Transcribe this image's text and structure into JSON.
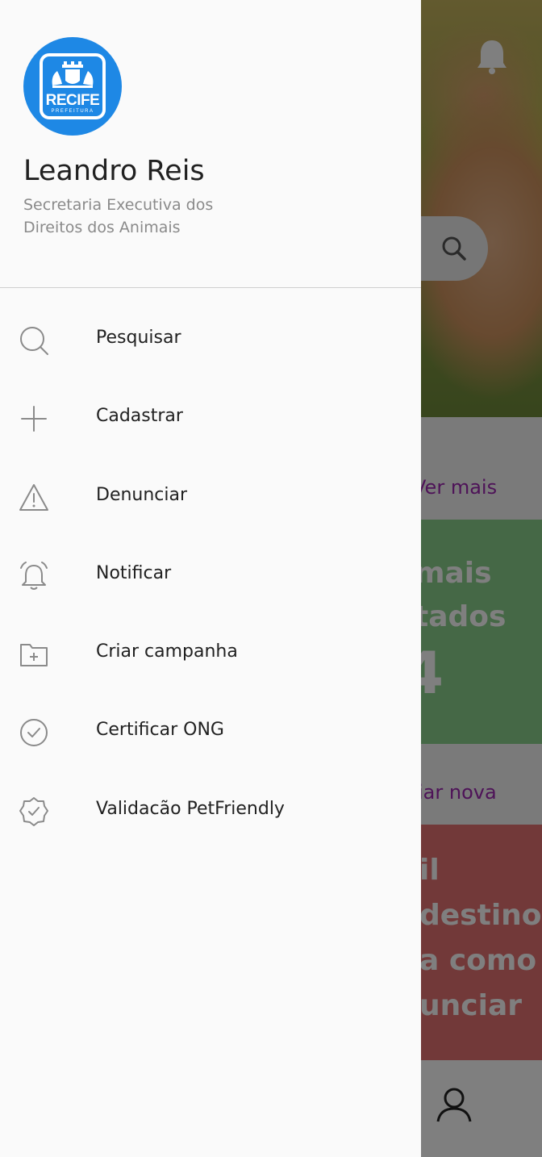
{
  "drawer": {
    "logo": {
      "brand": "RECIFE",
      "sub": "PREFEITURA"
    },
    "user": {
      "name": "Leandro Reis",
      "role": "Secretaria Executiva dos Direitos dos Animais"
    },
    "menu": [
      {
        "label": "Pesquisar",
        "icon": "search-icon"
      },
      {
        "label": "Cadastrar",
        "icon": "plus-icon"
      },
      {
        "label": "Denunciar",
        "icon": "warning-icon"
      },
      {
        "label": "Notificar",
        "icon": "alarm-bell-icon"
      },
      {
        "label": "Criar campanha",
        "icon": "folder-add-icon"
      },
      {
        "label": "Certificar ONG",
        "icon": "check-circle-icon"
      },
      {
        "label": "Validacão PetFriendly",
        "icon": "badge-check-icon"
      }
    ]
  },
  "background": {
    "see_more": "Ver mais",
    "stat_line1": "mais",
    "stat_line2": "tados",
    "stat_number": "4",
    "create_new": "iar nova",
    "campaign_lines": [
      "il",
      "destino,",
      "a como",
      "unciar"
    ]
  },
  "colors": {
    "accent_blue": "#1e88e5",
    "link_purple": "#9c27b0",
    "card_green": "#8bd08d",
    "card_red": "#e57373"
  }
}
